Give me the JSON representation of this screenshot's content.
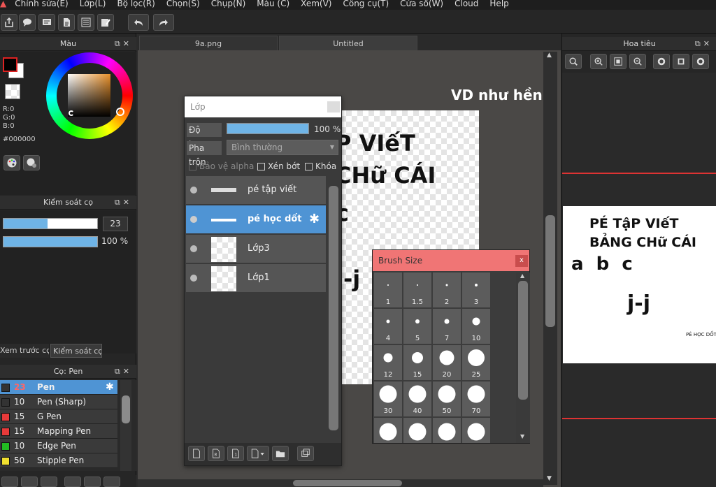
{
  "menu": [
    "▲",
    "Chỉnh sửa(E)",
    "Lớp(L)",
    "Bộ lọc(R)",
    "Chọn(S)",
    "Chụp(N)",
    "Màu (C)",
    "Xem(V)",
    "Công cụ(T)",
    "Cửa sổ(W)",
    "Cloud",
    "Help"
  ],
  "color_panel": {
    "title": "Màu",
    "r": "R:0",
    "g": "G:0",
    "b": "B:0",
    "hex": "#000000",
    "fg": "#000000",
    "bg": "#ffffff"
  },
  "brush_control": {
    "title": "Kiểm soát cọ",
    "size": "23",
    "opacity": "100 %",
    "size_fraction": 0.47,
    "opacity_fraction": 1.0
  },
  "left_tabs": [
    "Xem trước cọ",
    "Kiểm soát cọ"
  ],
  "pens": {
    "title": "Cọ: Pen",
    "items": [
      {
        "size": "23",
        "name": "Pen",
        "color": "#333333",
        "selected": true
      },
      {
        "size": "10",
        "name": "Pen (Sharp)",
        "color": "#333333"
      },
      {
        "size": "15",
        "name": "G Pen",
        "color": "#e83a3a"
      },
      {
        "size": "15",
        "name": "Mapping Pen",
        "color": "#e83a3a"
      },
      {
        "size": "10",
        "name": "Edge Pen",
        "color": "#22bb22"
      },
      {
        "size": "50",
        "name": "Stipple Pen",
        "color": "#f0e030"
      }
    ]
  },
  "doc_tabs": [
    "9a.png",
    "Untitled"
  ],
  "canvas": {
    "heading": "VD như hềnh",
    "line1": "P VIếT",
    "line2": "CHữ CÁI",
    "frag": "c",
    "frag2": "j-j"
  },
  "layer_panel": {
    "title": "Lớp",
    "opacity_label": "Độ trong",
    "opacity_value": "100 %",
    "opacity_fraction": 1.0,
    "blend_label": "Pha trộn",
    "blend_value": "Bình thường",
    "protect_alpha": "Bảo vệ alpha",
    "clipping": "Xén bớt",
    "lock": "Khóa",
    "layers": [
      {
        "name": "pé tập viết",
        "selected": false
      },
      {
        "name": "pé học dốt",
        "selected": true
      },
      {
        "name": "Lớp3",
        "selected": false
      },
      {
        "name": "Lớp1",
        "selected": false
      }
    ]
  },
  "brush_size": {
    "title": "Brush Size",
    "close": "x",
    "sizes": [
      "1",
      "1.5",
      "2",
      "3",
      "4",
      "5",
      "7",
      "10",
      "12",
      "15",
      "20",
      "25",
      "30",
      "40",
      "50",
      "70",
      "",
      "",
      "",
      ""
    ]
  },
  "navigator": {
    "title": "Hoa tiêu",
    "preview_line1": "PÉ TậP VIếT",
    "preview_line2": "BẢNG CHữ CÁI",
    "preview_line3": "a  b  c",
    "preview_frag": "j-j",
    "preview_small": "PÉ HỌC DỐT"
  }
}
